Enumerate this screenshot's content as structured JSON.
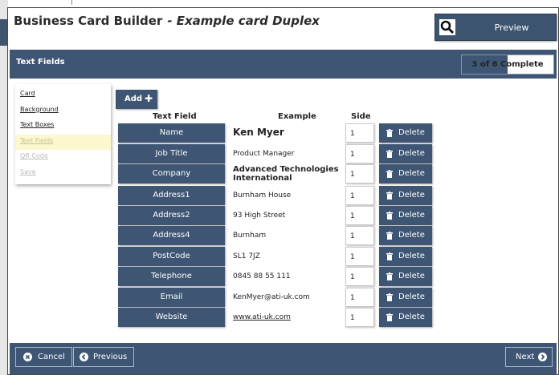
{
  "header": {
    "title": "Business Card Builder",
    "subtitle": "- Example card Duplex",
    "preview_label": "Preview"
  },
  "section": {
    "title": "Text Fields",
    "progress_text": "3 of 6 Complete",
    "progress_fraction": 0.5
  },
  "nav": {
    "items": [
      {
        "label": "Card",
        "state": "link"
      },
      {
        "label": "Background",
        "state": "link"
      },
      {
        "label": "Text Boxes",
        "state": "link"
      },
      {
        "label": "Text Fields",
        "state": "active"
      },
      {
        "label": "QR Code",
        "state": "disabled"
      },
      {
        "label": "Save",
        "state": "disabled"
      }
    ]
  },
  "toolbar": {
    "add_label": "Add",
    "add_icon": "plus-icon"
  },
  "table": {
    "headers": {
      "field": "Text Field",
      "example": "Example",
      "side": "Side"
    },
    "delete_label": "Delete",
    "rows": [
      {
        "field": "Name",
        "example": "Ken Myer",
        "side": "1",
        "style": "bold-large"
      },
      {
        "field": "Job Title",
        "example": "Product Manager",
        "side": "1",
        "style": "normal"
      },
      {
        "field": "Company",
        "example": "Advanced Technologies International",
        "side": "1",
        "style": "bold"
      },
      {
        "field": "Address1",
        "example": "Burnham House",
        "side": "1",
        "style": "normal"
      },
      {
        "field": "Address2",
        "example": "93 High Street",
        "side": "1",
        "style": "normal"
      },
      {
        "field": "Address4",
        "example": "Burnham",
        "side": "1",
        "style": "normal"
      },
      {
        "field": "PostCode",
        "example": "SL1 7JZ",
        "side": "1",
        "style": "normal"
      },
      {
        "field": "Telephone",
        "example": "0845 88 55 111",
        "side": "1",
        "style": "normal"
      },
      {
        "field": "Email",
        "example": "KenMyer@ati-uk.com",
        "side": "1",
        "style": "normal"
      },
      {
        "field": "Website",
        "example": "www.ati-uk.com",
        "side": "1",
        "style": "link"
      }
    ]
  },
  "footer": {
    "cancel_label": "Cancel",
    "previous_label": "Previous",
    "next_label": "Next"
  },
  "colors": {
    "accent": "#3e5573",
    "active_nav_bg": "#fdf7cf"
  }
}
